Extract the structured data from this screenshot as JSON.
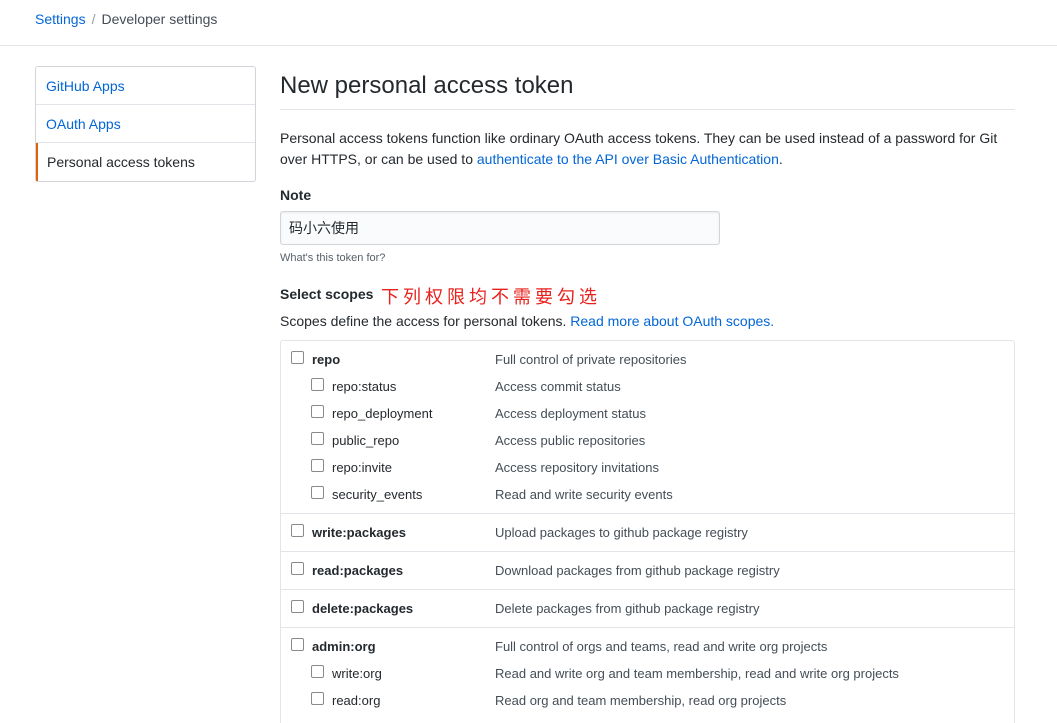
{
  "breadcrumb": {
    "settings": "Settings",
    "separator": "/",
    "current": "Developer settings"
  },
  "sidebar": {
    "items": [
      {
        "label": "GitHub Apps"
      },
      {
        "label": "OAuth Apps"
      },
      {
        "label": "Personal access tokens",
        "active": true
      }
    ]
  },
  "page": {
    "title": "New personal access token",
    "intro_text": "Personal access tokens function like ordinary OAuth access tokens. They can be used instead of a password for Git over HTTPS, or can be used to ",
    "intro_link": "authenticate to the API over Basic Authentication",
    "intro_end": "."
  },
  "note": {
    "label": "Note",
    "value": "码小六使用",
    "hint": "What's this token for?"
  },
  "scopes": {
    "label": "Select scopes",
    "annotation": "下列权限均不需要勾选",
    "desc_text": "Scopes define the access for personal tokens. ",
    "desc_link": "Read more about OAuth scopes.",
    "groups": [
      {
        "name": "repo",
        "desc": "Full control of private repositories",
        "checked": false,
        "children": [
          {
            "name": "repo:status",
            "desc": "Access commit status",
            "checked": false
          },
          {
            "name": "repo_deployment",
            "desc": "Access deployment status",
            "checked": false
          },
          {
            "name": "public_repo",
            "desc": "Access public repositories",
            "checked": false
          },
          {
            "name": "repo:invite",
            "desc": "Access repository invitations",
            "checked": false
          },
          {
            "name": "security_events",
            "desc": "Read and write security events",
            "checked": false
          }
        ]
      },
      {
        "name": "write:packages",
        "desc": "Upload packages to github package registry",
        "checked": false,
        "children": []
      },
      {
        "name": "read:packages",
        "desc": "Download packages from github package registry",
        "checked": false,
        "children": []
      },
      {
        "name": "delete:packages",
        "desc": "Delete packages from github package registry",
        "checked": false,
        "children": []
      },
      {
        "name": "admin:org",
        "desc": "Full control of orgs and teams, read and write org projects",
        "checked": false,
        "children": [
          {
            "name": "write:org",
            "desc": "Read and write org and team membership, read and write org projects",
            "checked": false
          },
          {
            "name": "read:org",
            "desc": "Read org and team membership, read org projects",
            "checked": false
          }
        ]
      }
    ]
  },
  "colors": {
    "link": "#0366d6",
    "accent": "#e36209",
    "annotation": "#e8211d",
    "border": "#e1e4e8"
  }
}
